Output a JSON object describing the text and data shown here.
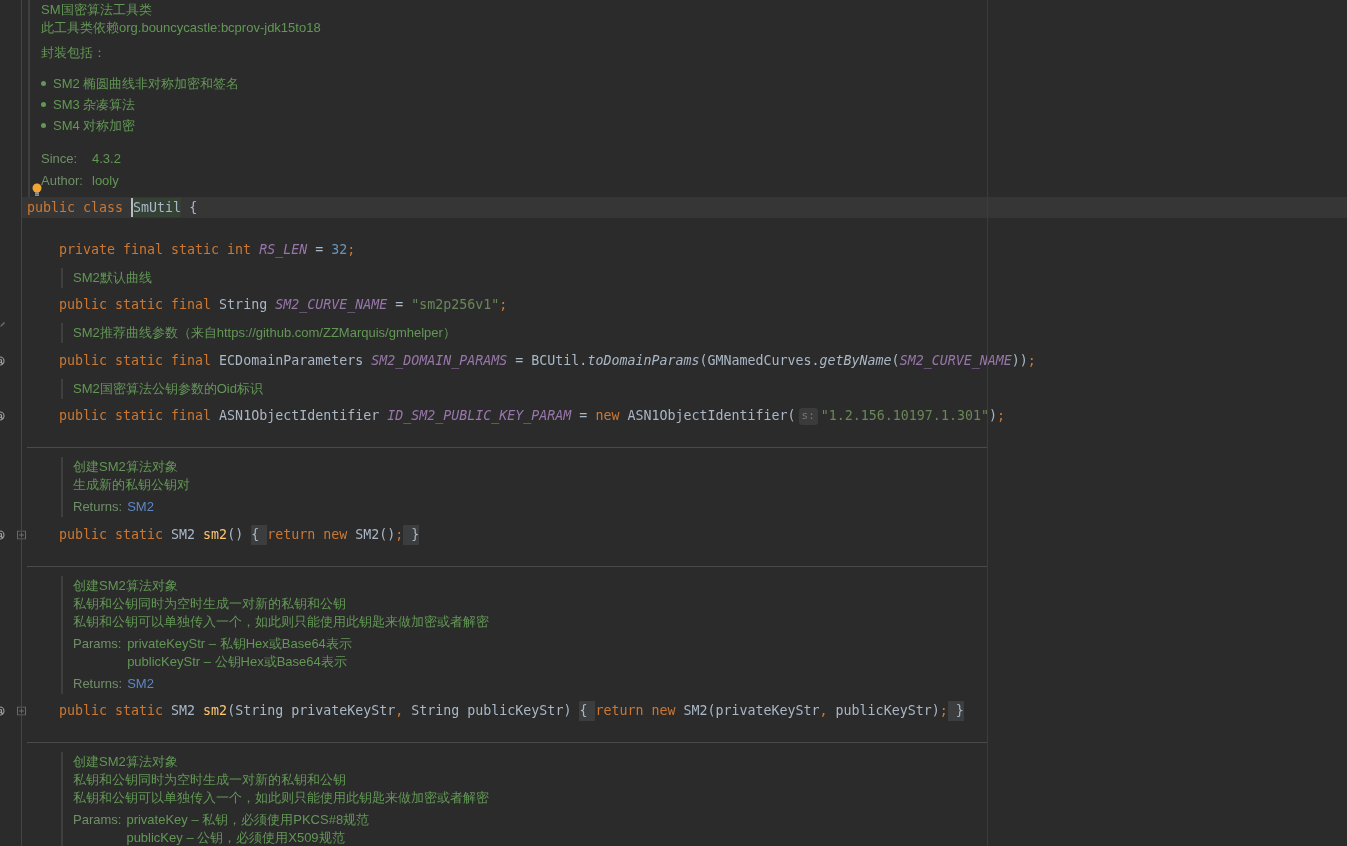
{
  "editor": {
    "blocks": [
      {
        "kind": "class_doc",
        "bulb": true,
        "items": [
          {
            "kind": "para",
            "lines": [
              "SM国密算法工具类",
              "此工具类依赖org.bouncycastle:bcprov-jdk15to18"
            ]
          },
          {
            "kind": "para",
            "lines": [
              "封装包括："
            ]
          },
          {
            "kind": "bullets",
            "items": [
              "SM2 椭圆曲线非对称加密和签名",
              "SM3 杂凑算法",
              "SM4 对称加密"
            ]
          },
          {
            "kind": "tags",
            "rows": [
              {
                "label": "Since:",
                "values": [
                  {
                    "text": "4.3.2",
                    "link": false
                  }
                ]
              },
              {
                "label": "Author:",
                "values": [
                  {
                    "text": "looly",
                    "link": false
                  }
                ]
              }
            ]
          }
        ]
      },
      {
        "kind": "class_header",
        "current": true,
        "foldable": false,
        "tokens": [
          {
            "kind": "kw",
            "text": "public class "
          },
          {
            "kind": "sel",
            "text": "SmUtil"
          },
          {
            "kind": "plain",
            "text": " {"
          }
        ]
      },
      {
        "kind": "member",
        "foldable": false,
        "tokens": [
          {
            "kind": "kw",
            "text": "private final static int "
          },
          {
            "kind": "const",
            "text": "RS_LEN"
          },
          {
            "kind": "plain",
            "text": " = "
          },
          {
            "kind": "num",
            "text": "32"
          },
          {
            "kind": "punct",
            "text": ";"
          }
        ]
      },
      {
        "kind": "doc",
        "items": [
          {
            "kind": "para",
            "lines": [
              "SM2默认曲线"
            ]
          }
        ]
      },
      {
        "kind": "member",
        "foldable": false,
        "tokens": [
          {
            "kind": "kw",
            "text": "public static final "
          },
          {
            "kind": "plain",
            "text": "String "
          },
          {
            "kind": "const",
            "text": "SM2_CURVE_NAME"
          },
          {
            "kind": "plain",
            "text": " = "
          },
          {
            "kind": "str",
            "text": "\"sm2p256v1\""
          },
          {
            "kind": "punct",
            "text": ";"
          }
        ]
      },
      {
        "kind": "doc",
        "marker": {
          "kind": "pencil"
        },
        "items": [
          {
            "kind": "para",
            "lines": [
              "SM2推荐曲线参数（来自https://github.com/ZZMarquis/gmhelper）"
            ]
          }
        ]
      },
      {
        "kind": "member",
        "foldable": false,
        "marker": {
          "kind": "at"
        },
        "tokens": [
          {
            "kind": "kw",
            "text": "public static final "
          },
          {
            "kind": "plain",
            "text": "ECDomainParameters "
          },
          {
            "kind": "const",
            "text": "SM2_DOMAIN_PARAMS"
          },
          {
            "kind": "plain",
            "text": " = BCUtil."
          },
          {
            "kind": "static",
            "text": "toDomainParams"
          },
          {
            "kind": "plain",
            "text": "(GMNamedCurves."
          },
          {
            "kind": "static",
            "text": "getByName"
          },
          {
            "kind": "plain",
            "text": "("
          },
          {
            "kind": "const",
            "text": "SM2_CURVE_NAME"
          },
          {
            "kind": "plain",
            "text": "))"
          },
          {
            "kind": "punct",
            "text": ";"
          }
        ]
      },
      {
        "kind": "doc",
        "items": [
          {
            "kind": "para",
            "lines": [
              "SM2国密算法公钥参数的Oid标识"
            ]
          }
        ]
      },
      {
        "kind": "member",
        "foldable": false,
        "marker": {
          "kind": "at"
        },
        "tokens": [
          {
            "kind": "kw",
            "text": "public static final "
          },
          {
            "kind": "plain",
            "text": "ASN1ObjectIdentifier "
          },
          {
            "kind": "const",
            "text": "ID_SM2_PUBLIC_KEY_PARAM"
          },
          {
            "kind": "plain",
            "text": " = "
          },
          {
            "kind": "kw",
            "text": "new "
          },
          {
            "kind": "plain",
            "text": "ASN1ObjectIdentifier("
          },
          {
            "kind": "hint",
            "text": "s:"
          },
          {
            "kind": "str",
            "text": "\"1.2.156.10197.1.301\""
          },
          {
            "kind": "plain",
            "text": ")"
          },
          {
            "kind": "punct",
            "text": ";"
          }
        ]
      },
      {
        "kind": "separator"
      },
      {
        "kind": "doc",
        "items": [
          {
            "kind": "para",
            "lines": [
              "创建SM2算法对象",
              "生成新的私钥公钥对"
            ]
          },
          {
            "kind": "tags",
            "rows": [
              {
                "label": "Returns:",
                "values": [
                  {
                    "text": "SM2",
                    "link": true
                  }
                ]
              }
            ]
          }
        ]
      },
      {
        "kind": "member",
        "foldable": true,
        "marker": {
          "kind": "at"
        },
        "tokens": [
          {
            "kind": "kw",
            "text": "public static "
          },
          {
            "kind": "plain",
            "text": "SM2 "
          },
          {
            "kind": "method",
            "text": "sm2"
          },
          {
            "kind": "plain",
            "text": "() "
          },
          {
            "kind": "fold",
            "text": "{ "
          },
          {
            "kind": "kw",
            "text": "return new "
          },
          {
            "kind": "plain",
            "text": "SM2()"
          },
          {
            "kind": "punct",
            "text": ";"
          },
          {
            "kind": "fold",
            "text": " }"
          }
        ]
      },
      {
        "kind": "separator"
      },
      {
        "kind": "doc",
        "items": [
          {
            "kind": "para",
            "lines": [
              "创建SM2算法对象",
              "私钥和公钥同时为空时生成一对新的私钥和公钥",
              "私钥和公钥可以单独传入一个，如此则只能使用此钥匙来做加密或者解密"
            ]
          },
          {
            "kind": "tags",
            "rows": [
              {
                "label": "Params:",
                "values": [
                  {
                    "text": "privateKeyStr – 私钥Hex或Base64表示",
                    "link": false
                  },
                  {
                    "text": "publicKeyStr – 公钥Hex或Base64表示",
                    "link": false
                  }
                ]
              },
              {
                "label": "Returns:",
                "values": [
                  {
                    "text": "SM2",
                    "link": true
                  }
                ]
              }
            ]
          }
        ]
      },
      {
        "kind": "member",
        "foldable": true,
        "marker": {
          "kind": "at"
        },
        "tokens": [
          {
            "kind": "kw",
            "text": "public static "
          },
          {
            "kind": "plain",
            "text": "SM2 "
          },
          {
            "kind": "method",
            "text": "sm2"
          },
          {
            "kind": "plain",
            "text": "(String privateKeyStr"
          },
          {
            "kind": "punct",
            "text": ", "
          },
          {
            "kind": "plain",
            "text": "String publicKeyStr) "
          },
          {
            "kind": "fold",
            "text": "{ "
          },
          {
            "kind": "kw",
            "text": "return new "
          },
          {
            "kind": "plain",
            "text": "SM2(privateKeyStr"
          },
          {
            "kind": "punct",
            "text": ", "
          },
          {
            "kind": "plain",
            "text": "publicKeyStr)"
          },
          {
            "kind": "punct",
            "text": ";"
          },
          {
            "kind": "fold",
            "text": " }"
          }
        ]
      },
      {
        "kind": "separator"
      },
      {
        "kind": "doc",
        "items": [
          {
            "kind": "para",
            "lines": [
              "创建SM2算法对象",
              "私钥和公钥同时为空时生成一对新的私钥和公钥",
              "私钥和公钥可以单独传入一个，如此则只能使用此钥匙来做加密或者解密"
            ]
          },
          {
            "kind": "tags",
            "rows": [
              {
                "label": "Params:",
                "values": [
                  {
                    "text": "privateKey – 私钥，必须使用PKCS#8规范",
                    "link": false
                  },
                  {
                    "text": "publicKey – 公钥，必须使用X509规范",
                    "link": false
                  }
                ]
              }
            ]
          }
        ]
      }
    ]
  }
}
